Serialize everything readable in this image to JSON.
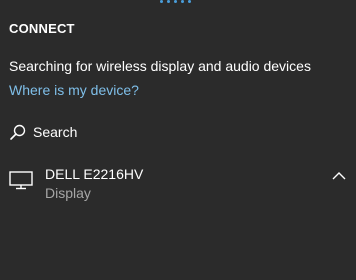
{
  "panel": {
    "title": "CONNECT",
    "status_text": "Searching for wireless display and audio devices",
    "help_link": "Where is my device?"
  },
  "search": {
    "label": "Search",
    "icon": "search-icon"
  },
  "devices": [
    {
      "name": "DELL E2216HV",
      "type": "Display",
      "icon": "monitor-icon",
      "expand_icon": "chevron-up-icon"
    }
  ],
  "colors": {
    "background": "#2b2b2b",
    "link": "#7fbfe9",
    "accent": "#4a9eda",
    "secondary_text": "#a6a6a6"
  }
}
